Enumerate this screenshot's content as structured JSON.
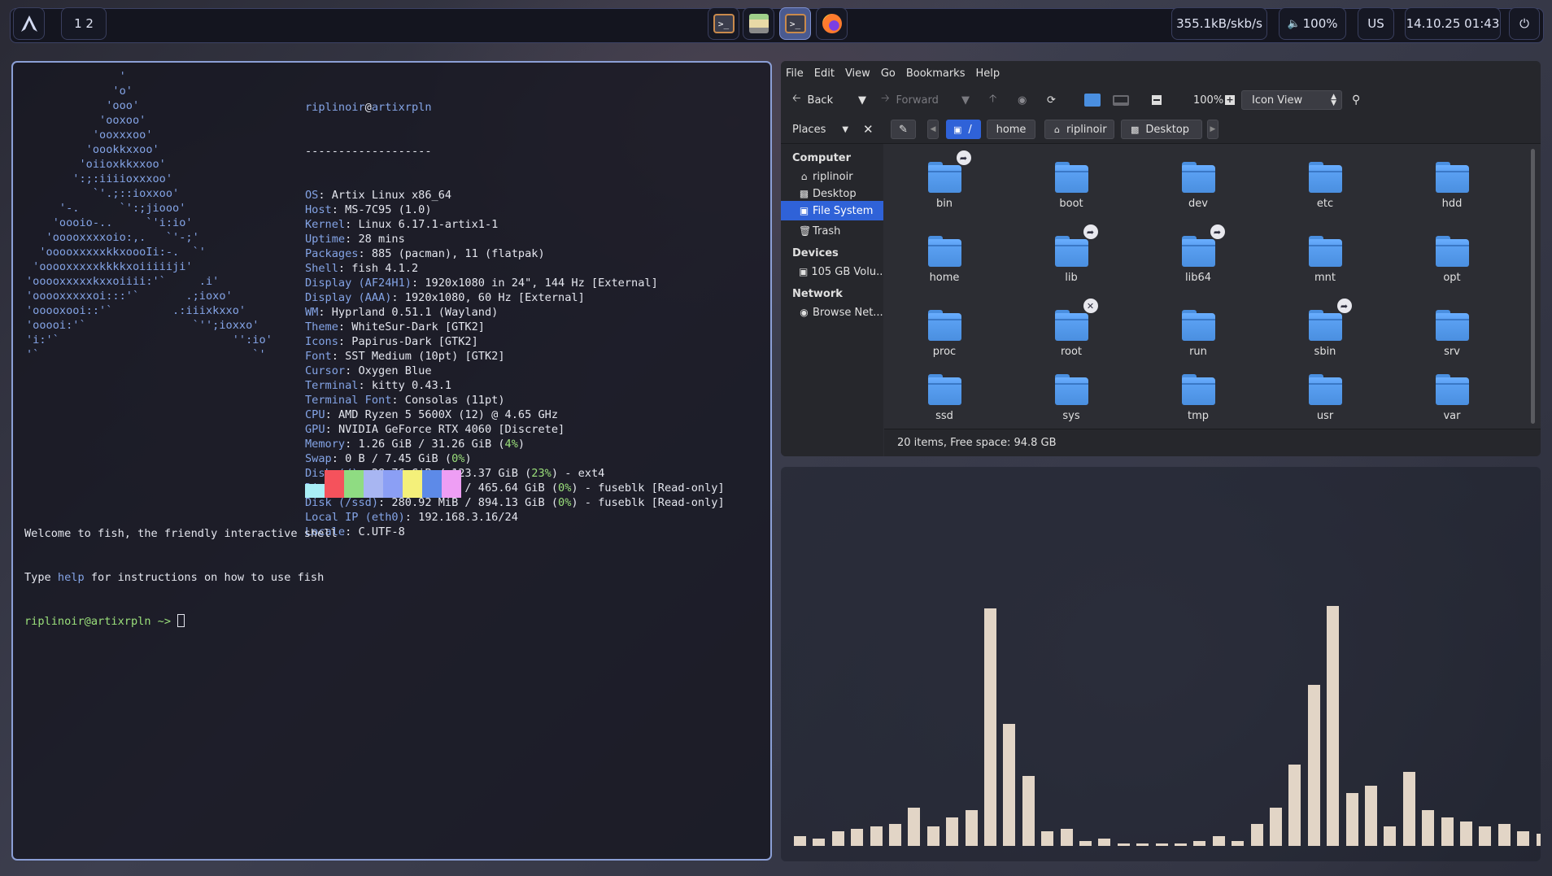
{
  "topbar": {
    "workspaces": "1 2",
    "network": "355.1kB/skb/s",
    "volume": "100%",
    "keyboard": "US",
    "clock": "14.10.25 01:43"
  },
  "terminal": {
    "logo": "              '\n             'o'\n            'ooo'\n           'ooxoo'\n          'ooxxxoo'\n         'oookkxxoo'\n        'oiioxkkxxoo'\n       ':;:iiiioxxxoo'\n          `'.;::ioxxoo'\n     '-.      `':;jiooo'\n    'oooio-..     `'i:io'\n   'ooooxxxxoio:,.   `'-;'\n  'ooooxxxxxkkxoooIi:-.  `'\n 'ooooxxxxxkkkkxoiiiiiji'\n'ooooxxxxxkxxoiiii:'`     .i'\n'ooooxxxxxoi:::'`       .;ioxo'\n'ooooxooi::'`         .:iiixkxxo'\n'ooooi:'`                `'';ioxxo'\n'i:'`                          '':io'\n'`                                `'",
    "user": "riplinoir",
    "host": "artixrpln",
    "separator": "-------------------",
    "info": [
      {
        "k": "OS",
        "v": "Artix Linux x86_64"
      },
      {
        "k": "Host",
        "v": "MS-7C95 (1.0)"
      },
      {
        "k": "Kernel",
        "v": "Linux 6.17.1-artix1-1"
      },
      {
        "k": "Uptime",
        "v": "28 mins"
      },
      {
        "k": "Packages",
        "v": "885 (pacman), 11 (flatpak)"
      },
      {
        "k": "Shell",
        "v": "fish 4.1.2"
      },
      {
        "k": "Display (AF24H1)",
        "v": "1920x1080 in 24\", 144 Hz [External]"
      },
      {
        "k": "Display (AAA)",
        "v": "1920x1080, 60 Hz [External]"
      },
      {
        "k": "WM",
        "v": "Hyprland 0.51.1 (Wayland)"
      },
      {
        "k": "Theme",
        "v": "WhiteSur-Dark [GTK2]"
      },
      {
        "k": "Icons",
        "v": "Papirus-Dark [GTK2]"
      },
      {
        "k": "Font",
        "v": "SST Medium (10pt) [GTK2]"
      },
      {
        "k": "Cursor",
        "v": "Oxygen Blue"
      },
      {
        "k": "Terminal",
        "v": "kitty 0.43.1"
      },
      {
        "k": "Terminal Font",
        "v": "Consolas (11pt)"
      },
      {
        "k": "CPU",
        "v": "AMD Ryzen 5 5600X (12) @ 4.65 GHz"
      },
      {
        "k": "GPU",
        "v": "NVIDIA GeForce RTX 4060 [Discrete]"
      },
      {
        "k": "Memory",
        "v": "1.26 GiB / 31.26 GiB (",
        "p": "4%",
        "t": ")"
      },
      {
        "k": "Swap",
        "v": "0 B / 7.45 GiB (",
        "p": "0%",
        "t": ")"
      },
      {
        "k": "Disk (/)",
        "v": "28.76 GiB / 123.37 GiB (",
        "p": "23%",
        "t": ") - ext4"
      },
      {
        "k": "Disk (/hdd)",
        "v": "106.71 MiB / 465.64 GiB (",
        "p": "0%",
        "t": ") - fuseblk [Read-only]"
      },
      {
        "k": "Disk (/ssd)",
        "v": "280.92 MiB / 894.13 GiB (",
        "p": "0%",
        "t": ") - fuseblk [Read-only]"
      },
      {
        "k": "Local IP (eth0)",
        "v": "192.168.3.16/24"
      },
      {
        "k": "Locale",
        "v": "C.UTF-8"
      }
    ],
    "swatches": [
      "#a9eef6",
      "#f5525c",
      "#8fdc82",
      "#a8b6f2",
      "#8b9ff5",
      "#f4f07a",
      "#5d8ae8",
      "#ee9ef4"
    ],
    "welcome1": "Welcome to fish, the friendly interactive shell",
    "welcome2a": "Type ",
    "welcome2b": "help",
    "welcome2c": " for instructions on how to use fish",
    "prompt": "riplinoir@artixrpln ~> "
  },
  "filemanager": {
    "menu": [
      "File",
      "Edit",
      "View",
      "Go",
      "Bookmarks",
      "Help"
    ],
    "back": "Back",
    "forward": "Forward",
    "zoom": "100%",
    "view_mode": "Icon View",
    "places_label": "Places",
    "crumbs": [
      "/",
      "home",
      "riplinoir",
      "Desktop"
    ],
    "sidebar": {
      "computer": "Computer",
      "items_computer": [
        "riplinoir",
        "Desktop",
        "File System",
        "Trash"
      ],
      "devices": "Devices",
      "items_devices": [
        "105 GB Volu..."
      ],
      "network": "Network",
      "items_network": [
        "Browse Net..."
      ]
    },
    "folders": [
      "bin",
      "boot",
      "dev",
      "etc",
      "hdd",
      "home",
      "lib",
      "lib64",
      "mnt",
      "opt",
      "proc",
      "root",
      "run",
      "sbin",
      "srv",
      "ssd",
      "sys",
      "tmp",
      "usr",
      "var"
    ],
    "status": "20 items, Free space: 94.8 GB"
  },
  "visualizer": {
    "levels": [
      0.04,
      0.03,
      0.06,
      0.07,
      0.08,
      0.09,
      0.16,
      0.08,
      0.12,
      0.15,
      0.99,
      0.51,
      0.29,
      0.06,
      0.07,
      0.02,
      0.03,
      0.01,
      0.01,
      0.01,
      0.01,
      0.02,
      0.04,
      0.02,
      0.09,
      0.16,
      0.34,
      0.67,
      1.0,
      0.22,
      0.25,
      0.08,
      0.31,
      0.15,
      0.12,
      0.1,
      0.08,
      0.09,
      0.06,
      0.05
    ]
  }
}
